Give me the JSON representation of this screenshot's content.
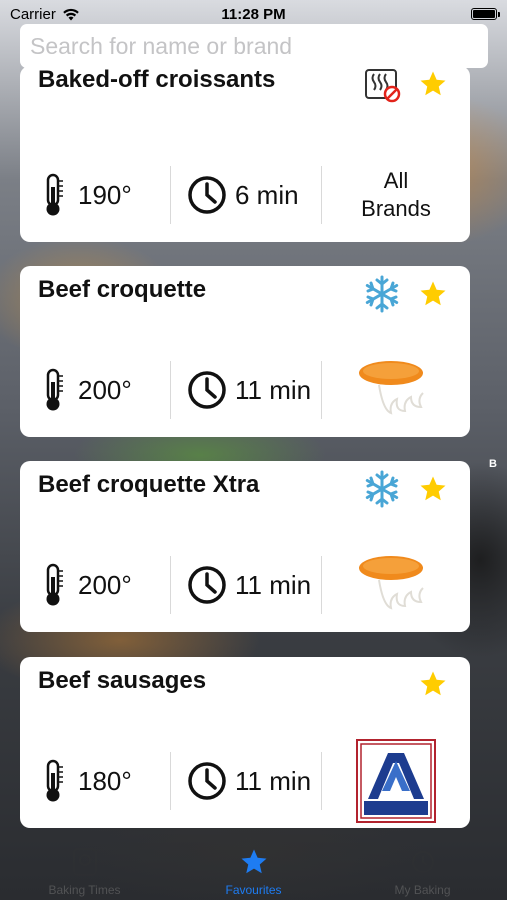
{
  "status": {
    "carrier": "Carrier",
    "time": "11:28 PM"
  },
  "search": {
    "placeholder": "Search for name or brand"
  },
  "items": [
    {
      "name": "Baked-off croissants",
      "temp": "190°",
      "time": "6 min",
      "brand": "All Brands",
      "brand_type": "text",
      "badge": "no-microwave-icon",
      "favourite": true
    },
    {
      "name": "Beef croquette",
      "temp": "200°",
      "time": "11 min",
      "brand": "mora",
      "brand_type": "mora-logo",
      "badge": "snowflake-icon",
      "favourite": true
    },
    {
      "name": "Beef croquette Xtra",
      "temp": "200°",
      "time": "11 min",
      "brand": "mora",
      "brand_type": "mora-logo",
      "badge": "snowflake-icon",
      "favourite": true
    },
    {
      "name": "Beef sausages",
      "temp": "180°",
      "time": "11 min",
      "brand": "ALDI",
      "brand_type": "aldi-logo",
      "badge": null,
      "favourite": true
    }
  ],
  "side_index": "B",
  "tabs": [
    {
      "label": "Baking Times",
      "icon": "baking-times-icon",
      "active": false
    },
    {
      "label": "Favourites",
      "icon": "star-icon",
      "active": true
    },
    {
      "label": "My Baking",
      "icon": "my-baking-icon",
      "active": false
    }
  ],
  "colors": {
    "accent": "#1e7cf2",
    "star": "#ffcc00",
    "snowflake": "#49a6d6",
    "mora": "#f08a1c",
    "aldi_blue": "#1d3c8f",
    "aldi_red": "#b2232e"
  }
}
